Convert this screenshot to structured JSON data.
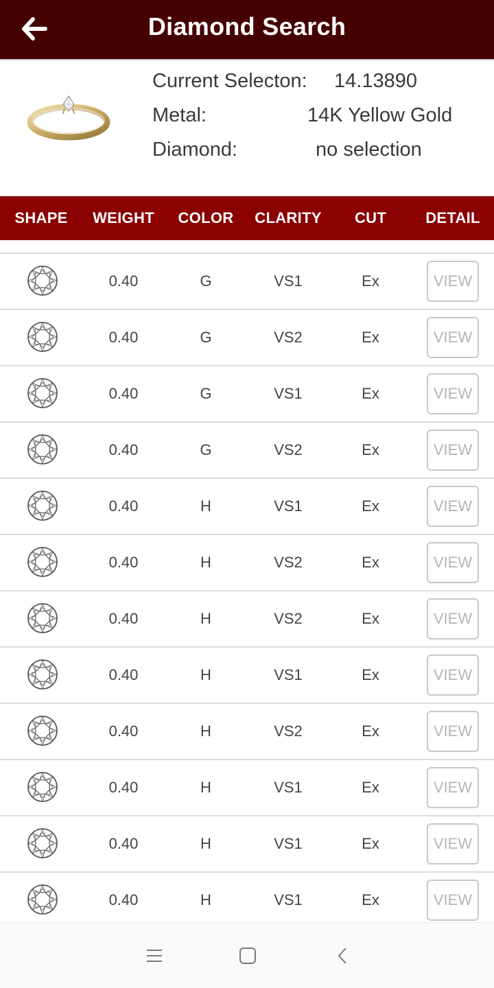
{
  "header": {
    "title": "Diamond Search",
    "back_icon": "arrow-left-icon"
  },
  "summary": {
    "selection_label": "Current Selecton:",
    "selection_value": "14.13890",
    "metal_label": "Metal:",
    "metal_value": "14K Yellow Gold",
    "diamond_label": "Diamond:",
    "diamond_value": "no selection"
  },
  "columns": [
    "SHAPE",
    "WEIGHT",
    "COLOR",
    "CLARITY",
    "CUT",
    "DETAIL"
  ],
  "view_label": "VIEW",
  "rows": [
    {
      "weight": "0.40",
      "color": "G",
      "clarity": "VS1",
      "cut": "Ex"
    },
    {
      "weight": "0.40",
      "color": "G",
      "clarity": "VS2",
      "cut": "Ex"
    },
    {
      "weight": "0.40",
      "color": "G",
      "clarity": "VS1",
      "cut": "Ex"
    },
    {
      "weight": "0.40",
      "color": "G",
      "clarity": "VS2",
      "cut": "Ex"
    },
    {
      "weight": "0.40",
      "color": "H",
      "clarity": "VS1",
      "cut": "Ex"
    },
    {
      "weight": "0.40",
      "color": "H",
      "clarity": "VS2",
      "cut": "Ex"
    },
    {
      "weight": "0.40",
      "color": "H",
      "clarity": "VS2",
      "cut": "Ex"
    },
    {
      "weight": "0.40",
      "color": "H",
      "clarity": "VS1",
      "cut": "Ex"
    },
    {
      "weight": "0.40",
      "color": "H",
      "clarity": "VS2",
      "cut": "Ex"
    },
    {
      "weight": "0.40",
      "color": "H",
      "clarity": "VS1",
      "cut": "Ex"
    },
    {
      "weight": "0.40",
      "color": "H",
      "clarity": "VS1",
      "cut": "Ex"
    },
    {
      "weight": "0.40",
      "color": "H",
      "clarity": "VS1",
      "cut": "Ex"
    }
  ],
  "nav": {
    "menu_icon": "menu-icon",
    "home_icon": "home-square-icon",
    "back_icon": "chevron-left-icon"
  },
  "colors": {
    "header_bg": "#450000",
    "column_header_bg": "#8b0000"
  }
}
